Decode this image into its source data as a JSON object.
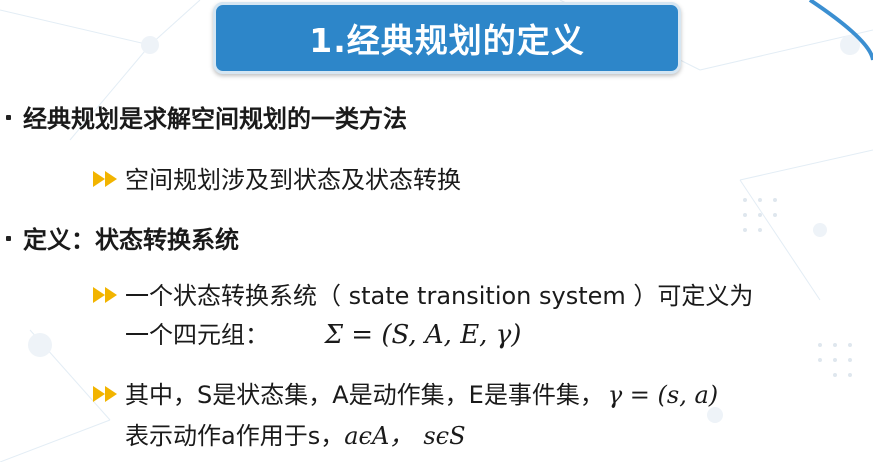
{
  "title": "1.经典规划的定义",
  "bullets": [
    {
      "text": "经典规划是求解空间规划的一类方法",
      "subs": [
        {
          "text": "空间规划涉及到状态及状态转换"
        }
      ]
    },
    {
      "text": "定义：状态转换系统",
      "subs": [
        {
          "line1": "一个状态转换系统（ state transition system ）可定义为",
          "line2_text": "一个四元组：",
          "line2_math": "Σ = (S, A, E, γ)"
        },
        {
          "line1_text": "其中，S是状态集，A是动作集，E是事件集，",
          "line1_math": "γ = (s, a)",
          "line2_text": "表示动作a作用于s，",
          "line2_math1": "aϵA，",
          "line2_math2": "sϵS"
        }
      ]
    }
  ],
  "colors": {
    "title_bg": "#2d86c9",
    "arrow": "#f2b400",
    "accent": "#3b8fd1"
  }
}
